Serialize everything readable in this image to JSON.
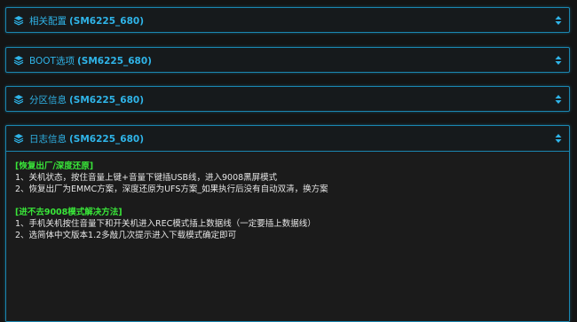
{
  "panels": [
    {
      "label": "相关配置",
      "device": "(SM6225_680)"
    },
    {
      "label": "BOOT选项",
      "device": "(SM6225_680)"
    },
    {
      "label": "分区信息",
      "device": "(SM6225_680)"
    },
    {
      "label": "日志信息",
      "device": "(SM6225_680)"
    }
  ],
  "log": {
    "section1_title": "[恢复出厂/深度还原]",
    "section1_lines": [
      "1、关机状态，按住音量上键+音量下键插USB线，进入9008黑屏模式",
      "2、恢复出厂为EMMC方案，深度还原为UFS方案_如果执行后没有自动双清，换方案"
    ],
    "section2_title": "[进不去9008模式解决方法]",
    "section2_lines": [
      "1、手机关机按住音量下和开关机进入REC模式插上数据线（一定要插上数据线）",
      "2、选简体中文版本1.2多敲几次提示进入下载模式确定即可"
    ]
  },
  "colors": {
    "accent": "#2fb4e8",
    "border": "#1b86b0",
    "log_head": "#39e639",
    "log_text": "#e6e6e6"
  },
  "icons": {
    "panel_icon": "layers-icon",
    "toggle_icon": "sort-icon"
  }
}
